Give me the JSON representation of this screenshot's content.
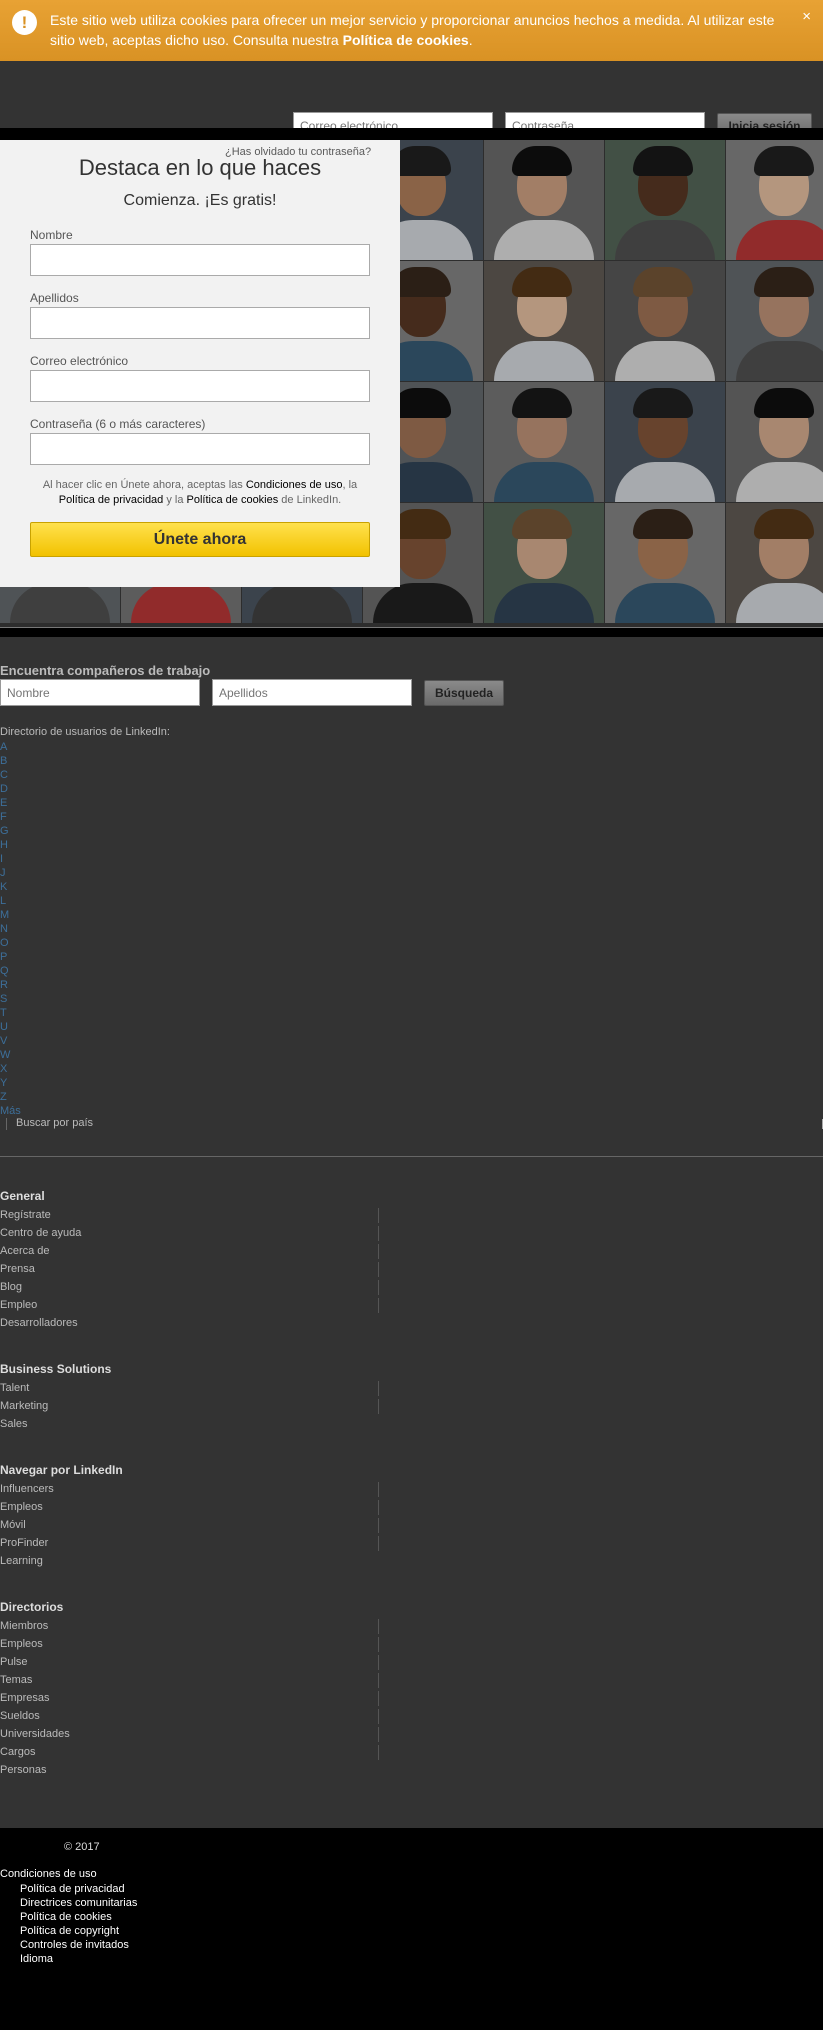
{
  "cookie_banner": {
    "text": "Este sitio web utiliza cookies para ofrecer un mejor servicio y proporcionar anuncios hechos a medida. Al utilizar este sitio web, aceptas dicho uso. Consulta nuestra ",
    "link": "Política de cookies",
    "suffix": ".",
    "close": "×",
    "icon": "!"
  },
  "login": {
    "email_placeholder": "Correo electrónico",
    "password_placeholder": "Contraseña",
    "submit": "Inicia sesión",
    "forgot": "¿Has olvidado tu contraseña?"
  },
  "signup": {
    "title": "Destaca en lo que haces",
    "subtitle": "Comienza. ¡Es gratis!",
    "first_name_label": "Nombre",
    "last_name_label": "Apellidos",
    "email_label": "Correo electrónico",
    "password_label": "Contraseña (6 o más caracteres)",
    "terms_1": "Al hacer clic en Únete ahora, aceptas las ",
    "terms_link_1": "Condiciones de uso",
    "terms_2": ", la ",
    "terms_link_2": "Política de privacidad",
    "terms_3": " y la ",
    "terms_link_3": "Política de cookies",
    "terms_4": " de LinkedIn.",
    "submit": "Únete ahora"
  },
  "find": {
    "title": "Encuentra compañeros de trabajo",
    "first_placeholder": "Nombre",
    "last_placeholder": "Apellidos",
    "submit": "Búsqueda"
  },
  "directory": {
    "title": "Directorio de usuarios de LinkedIn:",
    "letters": [
      "A",
      "B",
      "C",
      "D",
      "E",
      "F",
      "G",
      "H",
      "I",
      "J",
      "K",
      "L",
      "M",
      "N",
      "O",
      "P",
      "Q",
      "R",
      "S",
      "T",
      "U",
      "V",
      "W",
      "X",
      "Y",
      "Z",
      "Más"
    ],
    "by_country": "Buscar por país"
  },
  "footer_sections": [
    {
      "title": "General",
      "items": [
        "Regístrate",
        "Centro de ayuda",
        "Acerca de",
        "Prensa",
        "Blog",
        "Empleo",
        "Desarrolladores"
      ]
    },
    {
      "title": "Business Solutions",
      "items": [
        "Talent",
        "Marketing",
        "Sales"
      ]
    },
    {
      "title": "Navegar por LinkedIn",
      "items": [
        "Influencers",
        "Empleos",
        "Móvil",
        "ProFinder",
        "Learning"
      ]
    },
    {
      "title": "Directorios",
      "items": [
        "Miembros",
        "Empleos",
        "Pulse",
        "Temas",
        "Empresas",
        "Sueldos",
        "Universidades",
        "Cargos",
        "Personas"
      ]
    }
  ],
  "bottom": {
    "copyright": "© 2017",
    "first": "Condiciones de uso",
    "legal": [
      "Política de privacidad",
      "Directrices comunitarias",
      "Política de cookies",
      "Política de copyright",
      "Controles de invitados",
      "Idioma"
    ]
  },
  "colors": {
    "banner": "#e8a234",
    "join_button": "#f7cf1d",
    "background": "#333333",
    "link": "#3d6f9a"
  }
}
